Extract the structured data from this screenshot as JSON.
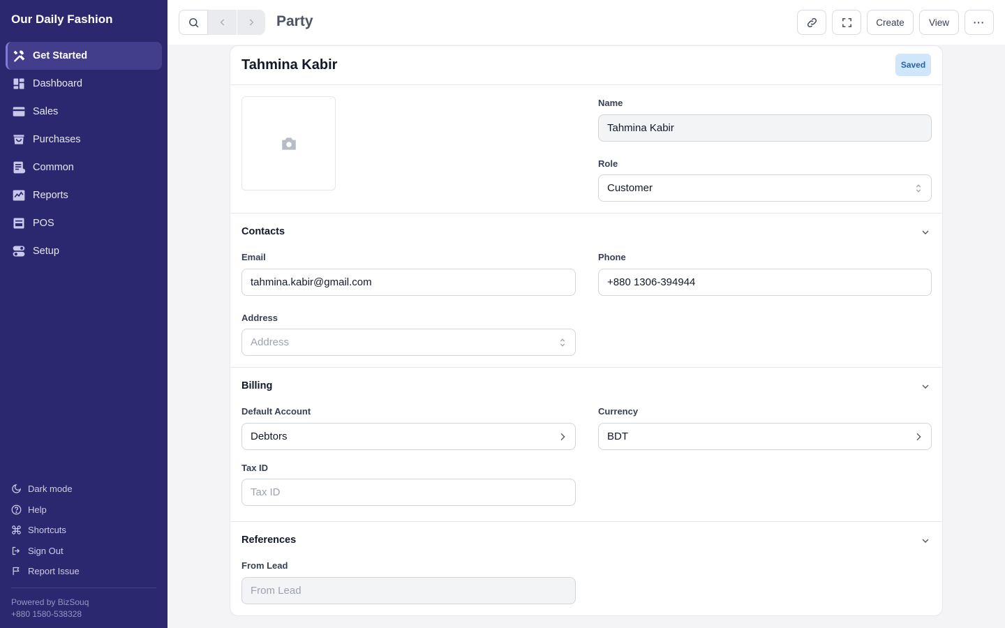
{
  "sidebar": {
    "brand": "Our Daily Fashion",
    "items": [
      {
        "label": "Get Started",
        "icon": "tools-icon"
      },
      {
        "label": "Dashboard",
        "icon": "dashboard-icon"
      },
      {
        "label": "Sales",
        "icon": "sales-icon"
      },
      {
        "label": "Purchases",
        "icon": "purchases-icon"
      },
      {
        "label": "Common",
        "icon": "common-icon"
      },
      {
        "label": "Reports",
        "icon": "reports-icon"
      },
      {
        "label": "POS",
        "icon": "pos-icon"
      },
      {
        "label": "Setup",
        "icon": "setup-icon"
      }
    ],
    "bottom": [
      {
        "label": "Dark mode",
        "icon": "moon-icon"
      },
      {
        "label": "Help",
        "icon": "help-icon"
      },
      {
        "label": "Shortcuts",
        "icon": "command-icon"
      },
      {
        "label": "Sign Out",
        "icon": "sign-out-icon"
      },
      {
        "label": "Report Issue",
        "icon": "flag-icon"
      }
    ],
    "powered_by": "Powered by BizSouq",
    "phone": "+880 1580-538328"
  },
  "topbar": {
    "title": "Party",
    "create_label": "Create",
    "view_label": "View",
    "more_label": "···"
  },
  "record": {
    "name": "Tahmina Kabir",
    "status": "Saved"
  },
  "form": {
    "name_label": "Name",
    "name_value": "Tahmina Kabir",
    "role_label": "Role",
    "role_value": "Customer",
    "contacts": {
      "title": "Contacts",
      "email_label": "Email",
      "email_value": "tahmina.kabir@gmail.com",
      "phone_label": "Phone",
      "phone_value": "+880 1306-394944",
      "address_label": "Address",
      "address_placeholder": "Address"
    },
    "billing": {
      "title": "Billing",
      "account_label": "Default Account",
      "account_value": "Debtors",
      "currency_label": "Currency",
      "currency_value": "BDT",
      "taxid_label": "Tax ID",
      "taxid_placeholder": "Tax ID"
    },
    "references": {
      "title": "References",
      "lead_label": "From Lead",
      "lead_placeholder": "From Lead"
    }
  },
  "colors": {
    "sidebar_bg": "#2b2870",
    "sidebar_active": "#423e8c",
    "badge_bg": "#cfe6fb",
    "badge_text": "#2563a8"
  }
}
